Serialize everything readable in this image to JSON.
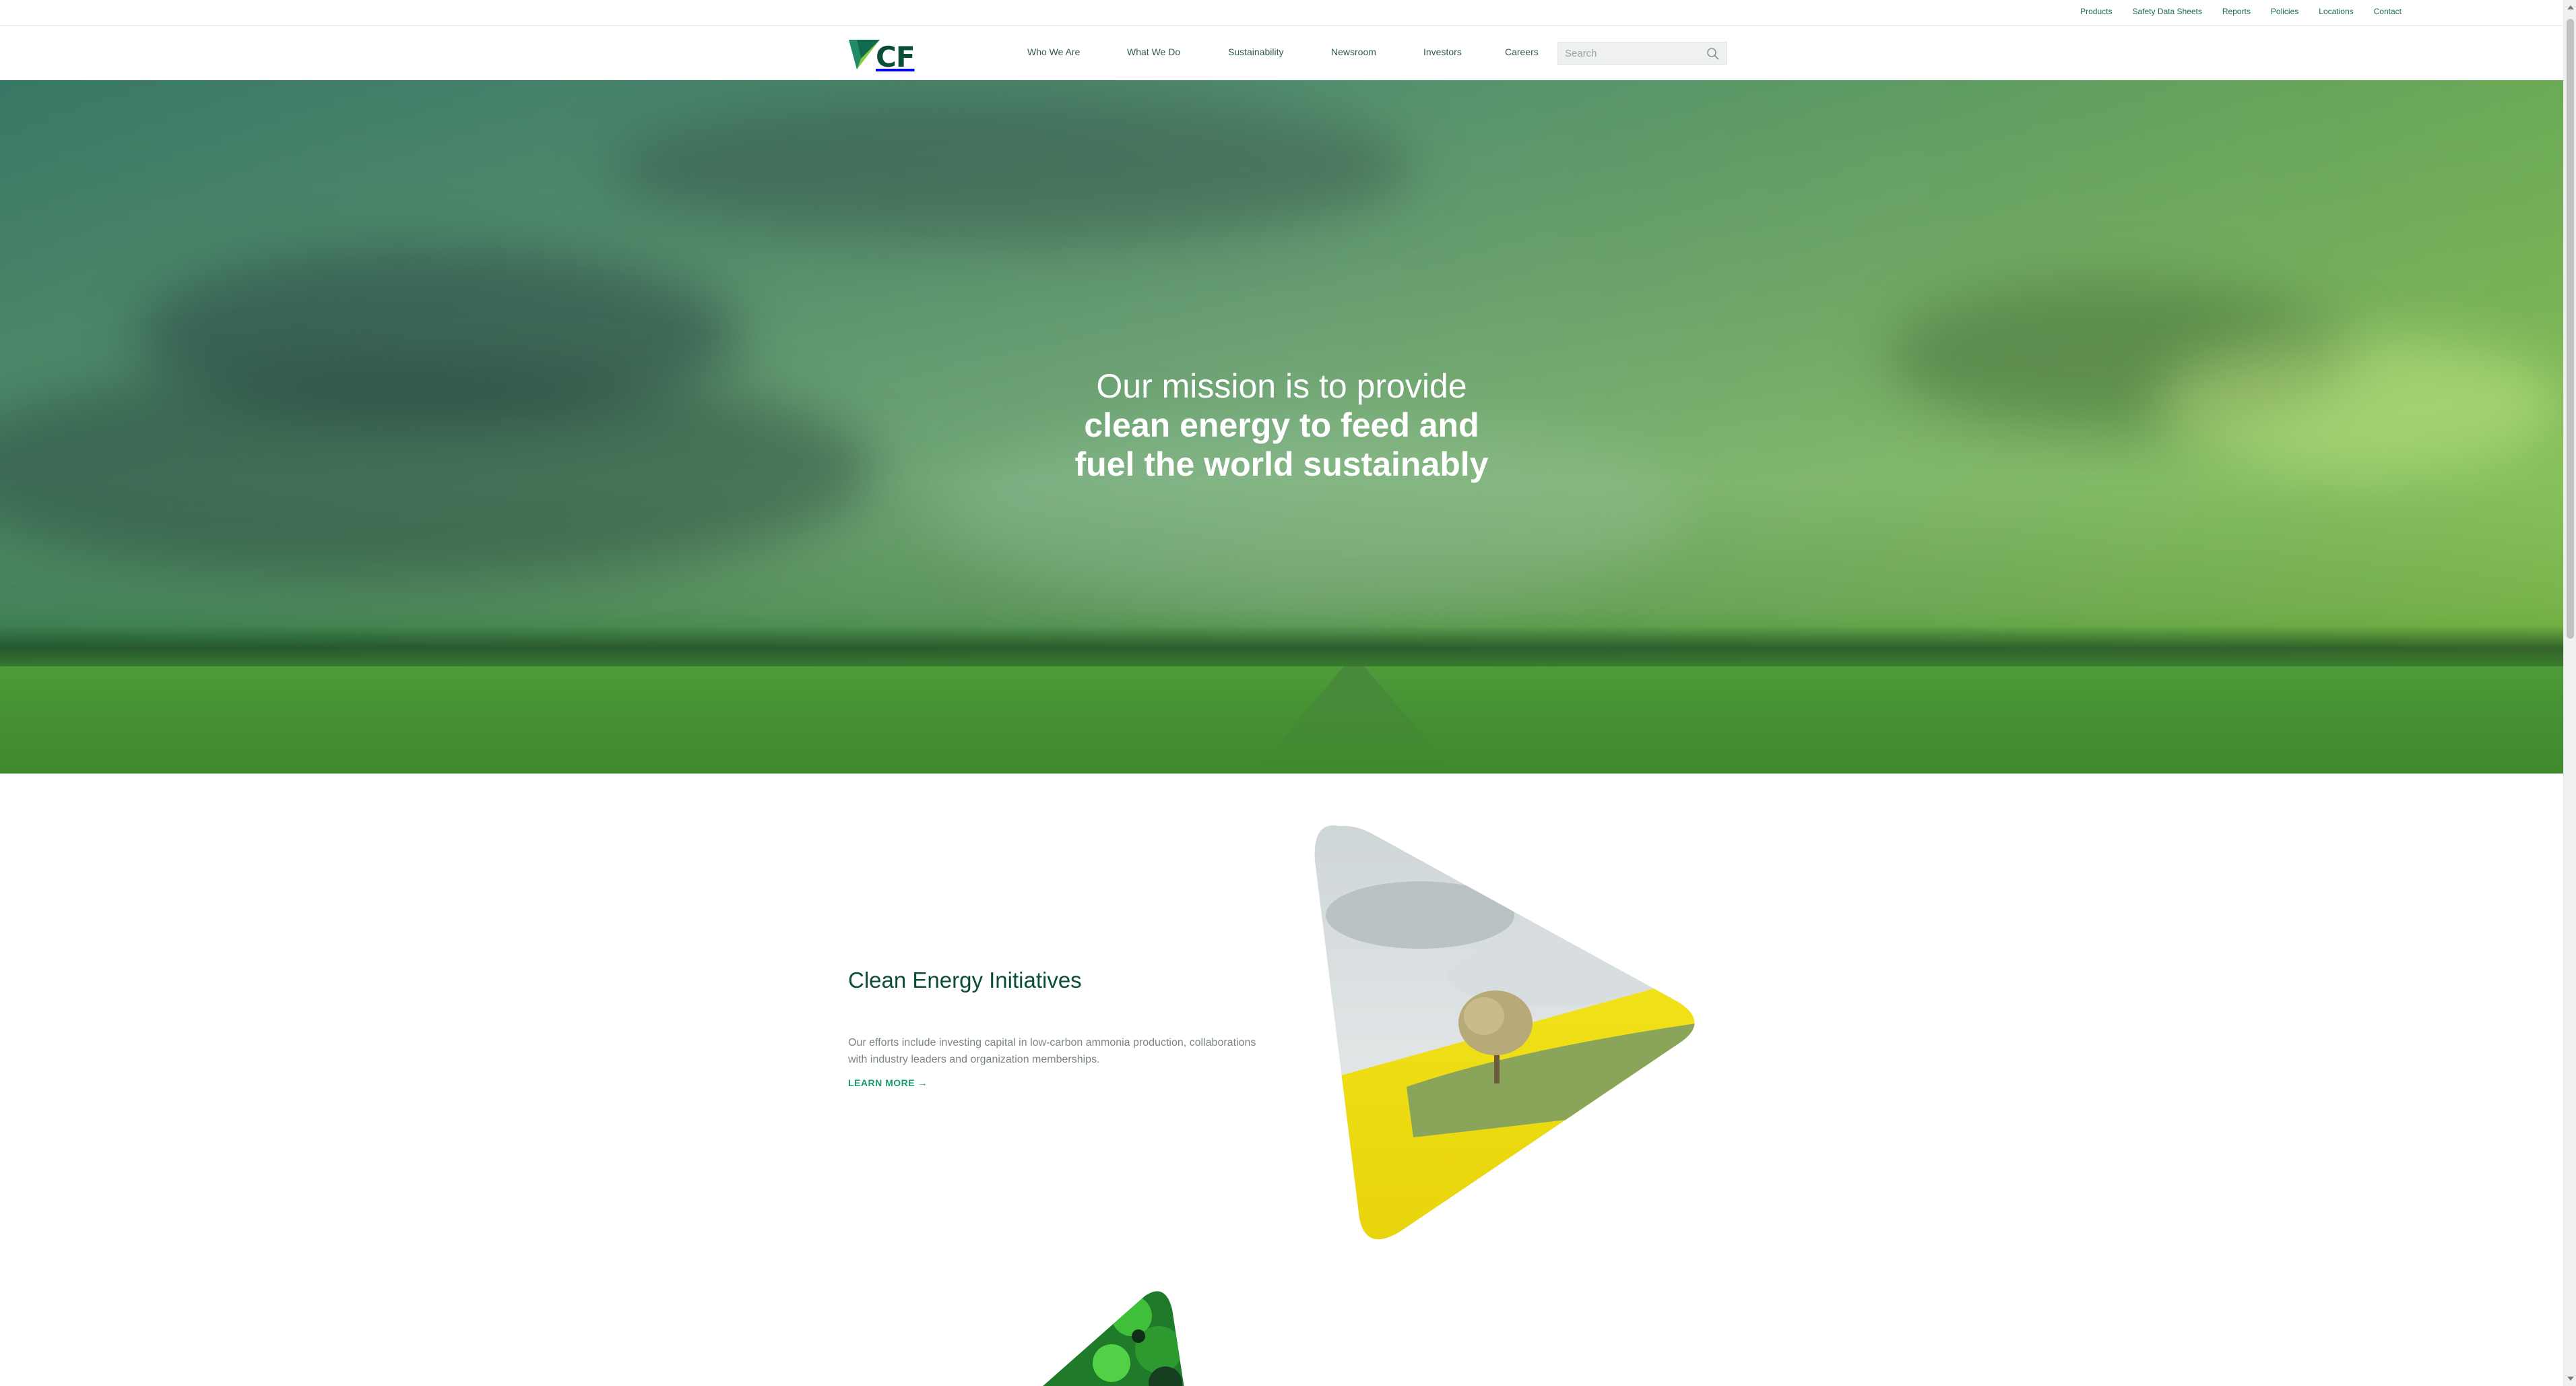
{
  "utility_nav": {
    "items": [
      "Products",
      "Safety Data Sheets",
      "Reports",
      "Policies",
      "Locations",
      "Contact"
    ]
  },
  "header": {
    "logo_text": "CF",
    "nav": [
      "Who We Are",
      "What We Do",
      "Sustainability",
      "Newsroom",
      "Investors",
      "Careers"
    ],
    "search_placeholder": "Search"
  },
  "hero": {
    "line1": "Our mission is to provide",
    "line2": "clean energy to feed and",
    "line3": "fuel the world sustainably"
  },
  "feature": {
    "title": "Clean Energy Initiatives",
    "body": "Our efforts include investing capital in low-carbon ammonia production, collaborations with industry leaders and organization memberships.",
    "cta": "LEARN MORE →"
  },
  "colors": {
    "brand_dark_green": "#0b4d38",
    "brand_accent_green": "#1a9a74",
    "logo_light_green": "#7fd13b"
  },
  "icons": [
    "cf-logo-icon",
    "search-icon"
  ]
}
